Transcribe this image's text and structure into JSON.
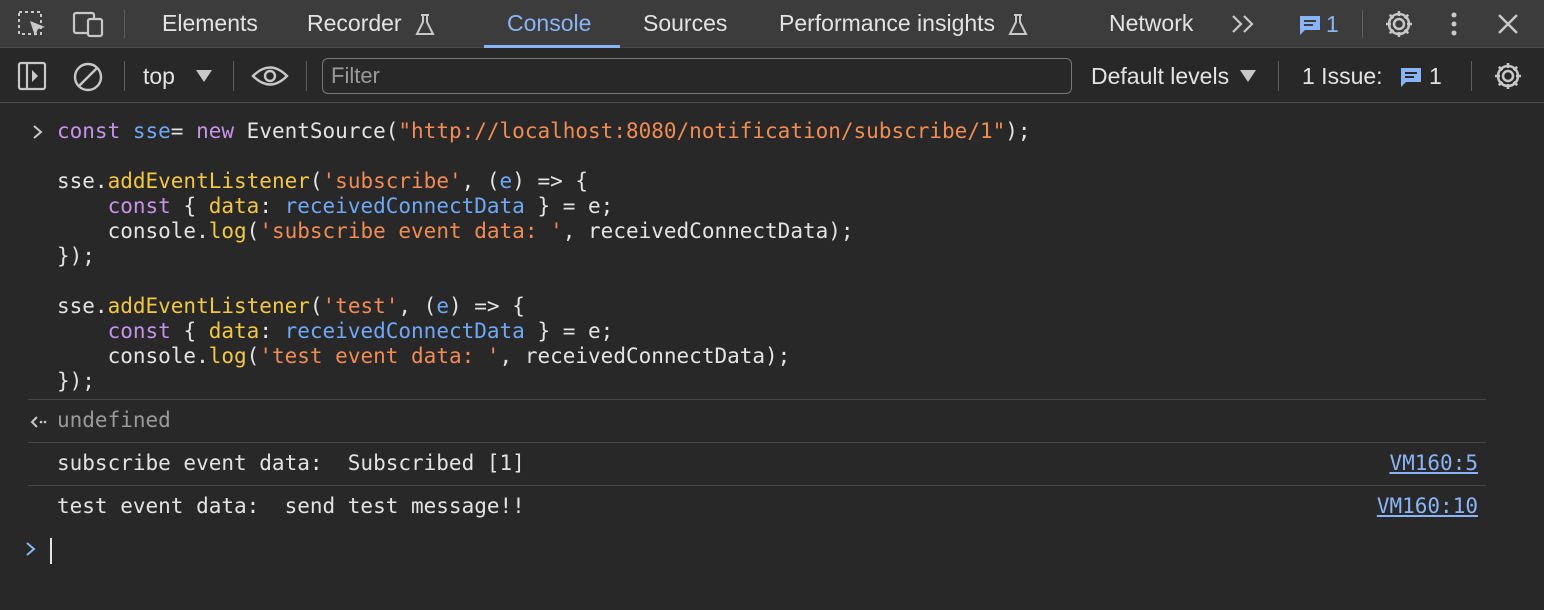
{
  "tabs": [
    {
      "label": "Elements"
    },
    {
      "label": "Recorder"
    },
    {
      "label": "Console"
    },
    {
      "label": "Sources"
    },
    {
      "label": "Performance insights"
    },
    {
      "label": "Network"
    }
  ],
  "tabbar": {
    "messages_count": "1"
  },
  "toolbar": {
    "context": "top",
    "filter_placeholder": "Filter",
    "levels": "Default levels",
    "issues_label": "1 Issue:",
    "issues_count": "1"
  },
  "console": {
    "input_lines": [
      [
        [
          "kw",
          "const "
        ],
        [
          "var",
          "sse"
        ],
        [
          "",
          "= "
        ],
        [
          "kw",
          "new "
        ],
        [
          "",
          "EventSource("
        ],
        [
          "str",
          "\"http://localhost:8080/notification/subscribe/1\""
        ],
        [
          "",
          ");"
        ]
      ],
      [],
      [
        [
          "",
          "sse."
        ],
        [
          "fn",
          "addEventListener"
        ],
        [
          "",
          "("
        ],
        [
          "str",
          "'subscribe'"
        ],
        [
          "",
          ", ("
        ],
        [
          "var",
          "e"
        ],
        [
          "",
          ") => {"
        ]
      ],
      [
        [
          "",
          "    "
        ],
        [
          "kw",
          "const "
        ],
        [
          "",
          "{ "
        ],
        [
          "prop",
          "data"
        ],
        [
          "",
          ": "
        ],
        [
          "var",
          "receivedConnectData"
        ],
        [
          "",
          " } = e;"
        ]
      ],
      [
        [
          "",
          "    console."
        ],
        [
          "fn",
          "log"
        ],
        [
          "",
          "("
        ],
        [
          "str",
          "'subscribe event data: '"
        ],
        [
          "",
          ", receivedConnectData);"
        ]
      ],
      [
        [
          "",
          "});"
        ]
      ],
      [],
      [
        [
          "",
          "sse."
        ],
        [
          "fn",
          "addEventListener"
        ],
        [
          "",
          "("
        ],
        [
          "str",
          "'test'"
        ],
        [
          "",
          ", ("
        ],
        [
          "var",
          "e"
        ],
        [
          "",
          ") => {"
        ]
      ],
      [
        [
          "",
          "    "
        ],
        [
          "kw",
          "const "
        ],
        [
          "",
          "{ "
        ],
        [
          "prop",
          "data"
        ],
        [
          "",
          ": "
        ],
        [
          "var",
          "receivedConnectData"
        ],
        [
          "",
          " } = e;"
        ]
      ],
      [
        [
          "",
          "    console."
        ],
        [
          "fn",
          "log"
        ],
        [
          "",
          "("
        ],
        [
          "str",
          "'test event data: '"
        ],
        [
          "",
          ", receivedConnectData);"
        ]
      ],
      [
        [
          "",
          "});"
        ]
      ]
    ],
    "result": "undefined",
    "logs": [
      {
        "text": "subscribe event data:  Subscribed [1]",
        "source": "VM160:5"
      },
      {
        "text": "test event data:  send test message!!",
        "source": "VM160:10"
      }
    ]
  },
  "colors": {
    "accent": "#8ab4f8",
    "keyword": "#c792ea",
    "variable": "#6fa8f7",
    "string": "#f28b54",
    "function": "#f2c744"
  }
}
